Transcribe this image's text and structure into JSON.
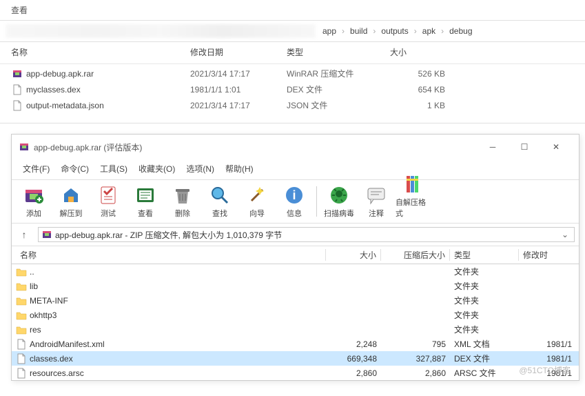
{
  "explorer": {
    "tab_label": "查看",
    "breadcrumb": [
      "app",
      "build",
      "outputs",
      "apk",
      "debug"
    ],
    "columns": {
      "name": "名称",
      "date": "修改日期",
      "type": "类型",
      "size": "大小"
    },
    "files": [
      {
        "icon": "rar",
        "name": "app-debug.apk.rar",
        "date": "2021/3/14 17:17",
        "type": "WinRAR 压缩文件",
        "size": "526 KB"
      },
      {
        "icon": "file",
        "name": "myclasses.dex",
        "date": "1981/1/1 1:01",
        "type": "DEX 文件",
        "size": "654 KB"
      },
      {
        "icon": "file",
        "name": "output-metadata.json",
        "date": "2021/3/14 17:17",
        "type": "JSON 文件",
        "size": "1 KB"
      }
    ]
  },
  "winrar": {
    "title": "app-debug.apk.rar (评估版本)",
    "menu": {
      "file": "文件(F)",
      "commands": "命令(C)",
      "tools": "工具(S)",
      "favorites": "收藏夹(O)",
      "options": "选项(N)",
      "help": "帮助(H)"
    },
    "toolbar": {
      "add": "添加",
      "extract": "解压到",
      "test": "测试",
      "view": "查看",
      "delete": "删除",
      "find": "查找",
      "wizard": "向导",
      "info": "信息",
      "scan": "扫描病毒",
      "comment": "注释",
      "sfx": "自解压格式"
    },
    "address": "app-debug.apk.rar - ZIP 压缩文件, 解包大小为 1,010,379 字节",
    "columns": {
      "name": "名称",
      "size": "大小",
      "compressed": "压缩后大小",
      "type": "类型",
      "date": "修改时间"
    },
    "columns_date_short": "修改时",
    "entries": [
      {
        "icon": "folder",
        "name": "..",
        "size": "",
        "compressed": "",
        "type": "文件夹",
        "date": ""
      },
      {
        "icon": "folder",
        "name": "lib",
        "size": "",
        "compressed": "",
        "type": "文件夹",
        "date": ""
      },
      {
        "icon": "folder",
        "name": "META-INF",
        "size": "",
        "compressed": "",
        "type": "文件夹",
        "date": ""
      },
      {
        "icon": "folder",
        "name": "okhttp3",
        "size": "",
        "compressed": "",
        "type": "文件夹",
        "date": ""
      },
      {
        "icon": "folder",
        "name": "res",
        "size": "",
        "compressed": "",
        "type": "文件夹",
        "date": ""
      },
      {
        "icon": "file",
        "name": "AndroidManifest.xml",
        "size": "2,248",
        "compressed": "795",
        "type": "XML 文档",
        "date": "1981/1"
      },
      {
        "icon": "file",
        "name": "classes.dex",
        "size": "669,348",
        "compressed": "327,887",
        "type": "DEX 文件",
        "date": "1981/1",
        "selected": true
      },
      {
        "icon": "file",
        "name": "resources.arsc",
        "size": "2,860",
        "compressed": "2,860",
        "type": "ARSC 文件",
        "date": "1981/1"
      }
    ]
  },
  "watermark": "@51CTO博客"
}
